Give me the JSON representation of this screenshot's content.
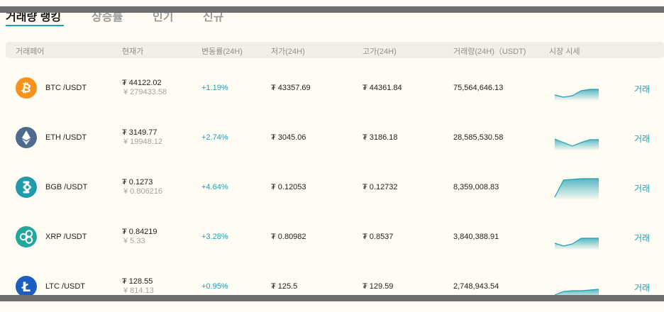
{
  "tabs": [
    {
      "label": "거래량 랭킹",
      "active": true
    },
    {
      "label": "상승률",
      "active": false
    },
    {
      "label": "인기",
      "active": false
    },
    {
      "label": "신규",
      "active": false
    }
  ],
  "columns": {
    "pair": "거래페어",
    "price": "현재가",
    "change": "변동률(24H)",
    "low": "저가(24H)",
    "high": "고가(24H)",
    "volume": "거래량(24H)（USDT)",
    "chart": "시장 시세"
  },
  "accent_color": "#1f9fb1",
  "rows": [
    {
      "icon": "bitcoin-icon",
      "icon_color": "#f7931a",
      "pair": "BTC /USDT",
      "price": "₮ 44122.02",
      "cny": "¥ 279433.58",
      "change": "+1.19%",
      "low": "₮ 43357.69",
      "high": "₮ 44361.84",
      "volume": "75,564,646.13",
      "trade": "거래",
      "trend": [
        6,
        3,
        5,
        12,
        14,
        14
      ]
    },
    {
      "icon": "ethereum-icon",
      "icon_color": "#4e6a8c",
      "pair": "ETH /USDT",
      "price": "₮ 3149.77",
      "cny": "¥ 19948.12",
      "change": "+2.74%",
      "low": "₮ 3045.06",
      "high": "₮ 3186.18",
      "volume": "28,585,530.58",
      "trade": "거래",
      "trend": [
        14,
        9,
        4,
        9,
        13,
        13
      ]
    },
    {
      "icon": "bgb-icon",
      "icon_color": "#1e9cab",
      "pair": "BGB /USDT",
      "price": "₮ 0.1273",
      "cny": "¥ 0.806216",
      "change": "+4.64%",
      "low": "₮ 0.12053",
      "high": "₮ 0.12732",
      "volume": "8,359,008.83",
      "trade": "거래",
      "trend": [
        2,
        26,
        27,
        28,
        28,
        28
      ]
    },
    {
      "icon": "xrp-icon",
      "icon_color": "#22a89c",
      "pair": "XRP /USDT",
      "price": "₮ 0.84219",
      "cny": "¥ 5.33",
      "change": "+3.28%",
      "low": "₮ 0.80982",
      "high": "₮ 0.8537",
      "volume": "3,840,388.91",
      "trade": "거래",
      "trend": [
        7,
        3,
        6,
        14,
        14,
        14
      ]
    },
    {
      "icon": "litecoin-icon",
      "icon_color": "#1a5fbe",
      "pair": "LTC /USDT",
      "price": "₮ 128.55",
      "cny": "¥ 814.13",
      "change": "+0.95%",
      "low": "₮ 125.5",
      "high": "₮ 129.59",
      "volume": "2,748,943.54",
      "trade": "거래",
      "trend": [
        4,
        9,
        10,
        10,
        11,
        12
      ]
    }
  ]
}
